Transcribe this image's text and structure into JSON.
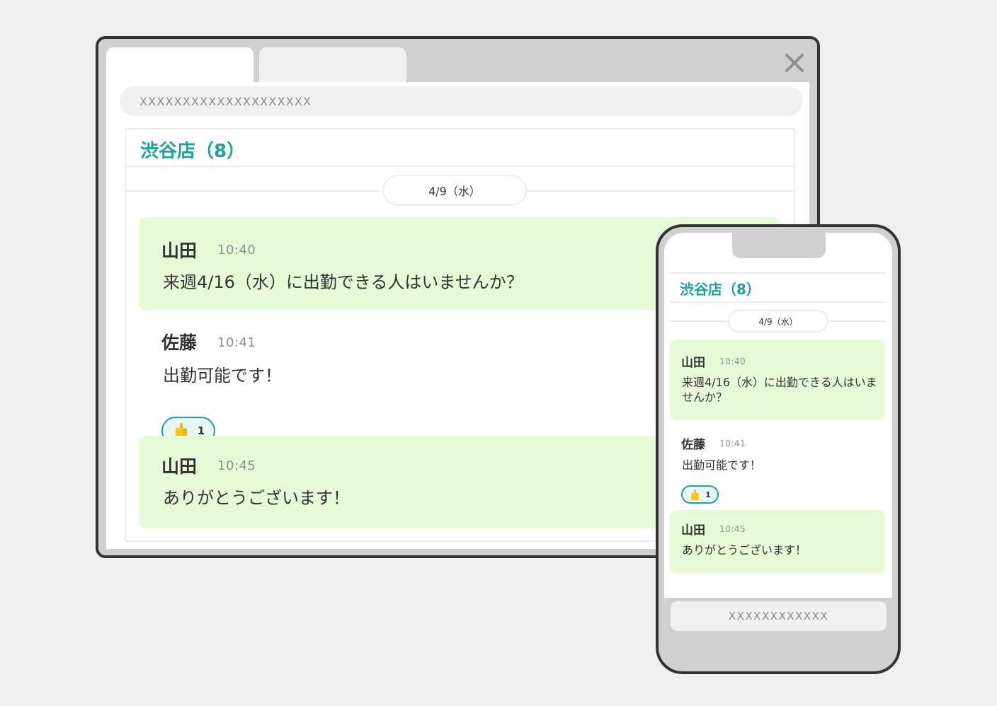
{
  "colors": {
    "accent": "#1ba39c",
    "bubble": "#e6fad8",
    "frame": "#333333",
    "chrome": "#cfd0cf",
    "reaction_bg": "#e6f7f5"
  },
  "desktop": {
    "close_icon": "close-x-icon",
    "url": "XXXXXXXXXXXXXXXXXXXX",
    "channel_title": "渋谷店（8）",
    "date_label": "4/9（水）",
    "messages": [
      {
        "name": "山田",
        "time": "10:40",
        "text": "来週4/16（水）に出勤できる人はいませんか？",
        "highlighted": true
      },
      {
        "name": "佐藤",
        "time": "10:41",
        "text": "出勤可能です！",
        "highlighted": false,
        "reaction": {
          "icon": "thumbs-up-icon",
          "count": "1"
        }
      },
      {
        "name": "山田",
        "time": "10:45",
        "text": "ありがとうございます！",
        "highlighted": true
      }
    ]
  },
  "phone": {
    "channel_title": "渋谷店（8）",
    "date_label": "4/9（水）",
    "messages": [
      {
        "name": "山田",
        "time": "10:40",
        "text": "来週4/16（水）に出勤できる人はいませんか？",
        "highlighted": true
      },
      {
        "name": "佐藤",
        "time": "10:41",
        "text": "出勤可能です！",
        "highlighted": false,
        "reaction": {
          "icon": "thumbs-up-icon",
          "count": "1"
        }
      },
      {
        "name": "山田",
        "time": "10:45",
        "text": "ありがとうございます！",
        "highlighted": true
      }
    ],
    "url": "XXXXXXXXXXXX"
  }
}
